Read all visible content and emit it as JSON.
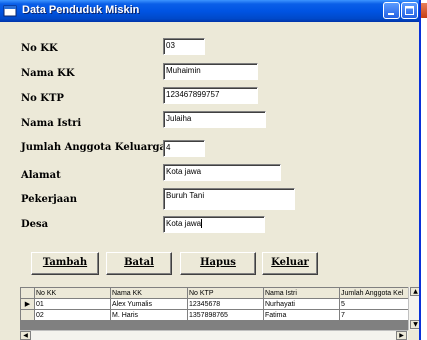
{
  "window": {
    "title": "Data Penduduk Miskin",
    "icon": "app-icon"
  },
  "form": {
    "no_kk": {
      "label": "No KK",
      "value": "03"
    },
    "nama_kk": {
      "label": "Nama KK",
      "value": "Muhaimin"
    },
    "no_ktp": {
      "label": "No KTP",
      "value": "123467899757"
    },
    "nama_istri": {
      "label": "Nama Istri",
      "value": "Julaiha"
    },
    "jumlah_anggota": {
      "label": "Jumlah Anggota Keluarga",
      "value": "4"
    },
    "alamat": {
      "label": "Alamat",
      "value": "Kota jawa"
    },
    "pekerjaan": {
      "label": "Pekerjaan",
      "value": "Buruh Tani"
    },
    "desa": {
      "label": "Desa",
      "value": "Kota jawa"
    }
  },
  "buttons": {
    "tambah": "Tambah",
    "batal": "Batal",
    "hapus": "Hapus",
    "keluar": "Keluar"
  },
  "grid": {
    "columns": [
      "No KK",
      "Nama KK",
      "No KTP",
      "Nama Istri",
      "Jumlah Anggota Kel"
    ],
    "rows": [
      [
        "01",
        "Alex Yumalis",
        "12345678",
        "Nurhayati",
        "5"
      ],
      [
        "02",
        "M. Haris",
        "1357898765",
        "Fatima",
        "7"
      ]
    ],
    "current_row_marker": "▶"
  },
  "colors": {
    "titlebar": "#0054e3",
    "window_bg": "#ece9d8",
    "close_button": "#c63e14"
  }
}
